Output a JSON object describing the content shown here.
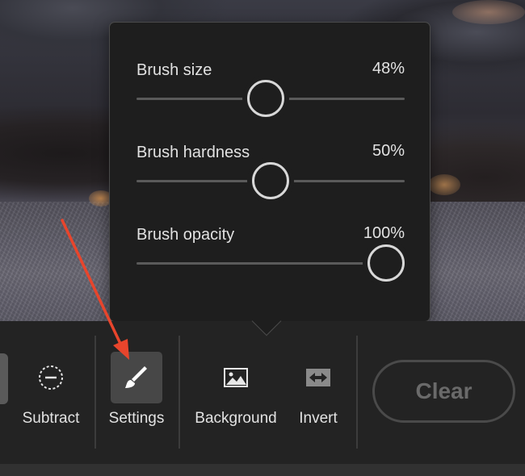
{
  "popover": {
    "sliders": [
      {
        "label": "Brush size",
        "value": "48%",
        "level": 0.48
      },
      {
        "label": "Brush hardness",
        "value": "50%",
        "level": 0.5
      },
      {
        "label": "Brush opacity",
        "value": "100%",
        "level": 1.0
      }
    ]
  },
  "toolbar": {
    "tools": [
      {
        "label": "Subtract",
        "icon": "subtract-circle-icon",
        "active": false
      },
      {
        "label": "Settings",
        "icon": "brush-icon",
        "active": true
      },
      {
        "label": "Background",
        "icon": "image-icon",
        "active": false
      },
      {
        "label": "Invert",
        "icon": "invert-arrows-icon",
        "active": false
      }
    ],
    "clear_label": "Clear"
  },
  "annotation": {
    "color": "#e8452c"
  }
}
